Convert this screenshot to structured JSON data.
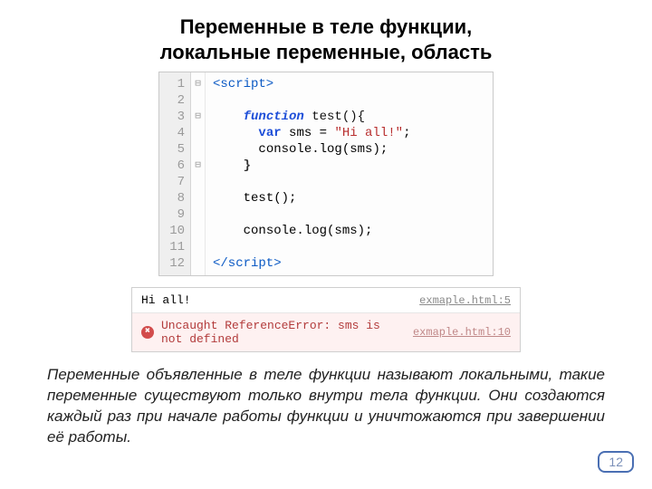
{
  "title_line1": "Переменные в теле функции,",
  "title_line2": "локальные переменные, область",
  "code": {
    "lines": [
      "1",
      "2",
      "3",
      "4",
      "5",
      "6",
      "7",
      "8",
      "9",
      "10",
      "11",
      "12"
    ],
    "fold": [
      "⊟",
      "",
      "⊟",
      "",
      "",
      "⊟",
      "",
      "",
      "",
      "",
      "",
      ""
    ],
    "l1_open": "<script>",
    "l3_kw": "function",
    "l3_name": " test(){",
    "l4_var": "var",
    "l4_rest": " sms = ",
    "l4_str": "\"Hi all!\"",
    "l4_semi": ";",
    "l5": "console.log(sms);",
    "l6": "}",
    "l8": "test();",
    "l10": "console.log(sms);",
    "l12_close": "</script>"
  },
  "console": {
    "row1_msg": "Hi all!",
    "row1_src": "exmaple.html:5",
    "row2_msg": "Uncaught ReferenceError: sms is not defined",
    "row2_src": "exmaple.html:10"
  },
  "paragraph": "Переменные объявленные в теле функции называют локальными, такие переменные существуют только внутри тела функции. Они создаются каждый раз при начале работы функции и уничтожаются при завершении её работы.",
  "page_number": "12"
}
